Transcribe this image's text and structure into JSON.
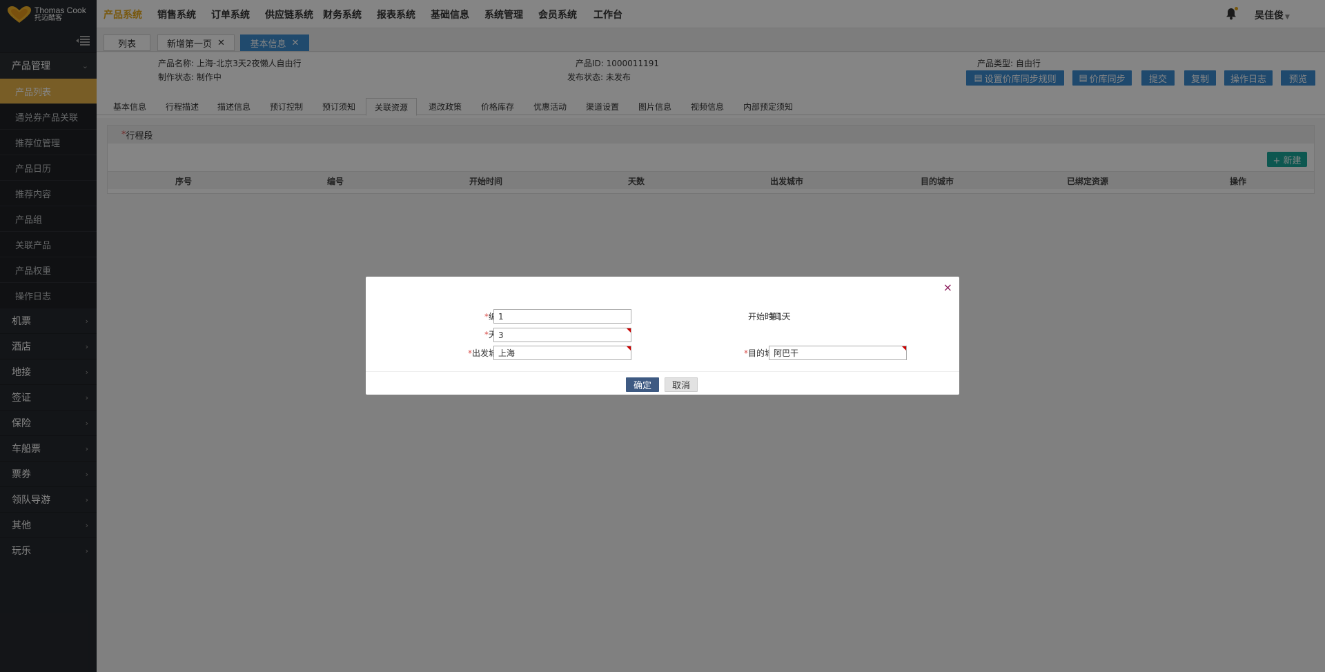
{
  "brand": {
    "name_en": "Thomas Cook",
    "name_cn": "托迈酷客"
  },
  "topnav": [
    "产品系统",
    "销售系统",
    "订单系统",
    "供应链系统",
    "财务系统",
    "报表系统",
    "基础信息",
    "系统管理",
    "会员系统",
    "工作台"
  ],
  "topnav_active": "产品系统",
  "user": {
    "name": "吴佳俊"
  },
  "sidebar": {
    "product_mgmt": "产品管理",
    "sub_items": [
      "产品列表",
      "通兑券产品关联",
      "推荐位管理",
      "产品日历",
      "推荐内容",
      "产品组",
      "关联产品",
      "产品权重",
      "操作日志"
    ],
    "groups": [
      "机票",
      "酒店",
      "地接",
      "签证",
      "保险",
      "车船票",
      "票券",
      "领队导游",
      "其他",
      "玩乐"
    ]
  },
  "tabs": [
    {
      "label": "列表"
    },
    {
      "label": "新增第一页",
      "close": "✕"
    },
    {
      "label": "基本信息",
      "close": "✕"
    }
  ],
  "info": {
    "product_name": "产品名称: 上海-北京3天2夜懒人自由行",
    "product_id": "产品ID: 1000011191",
    "product_type": "产品类型: 自由行",
    "make_status": "制作状态: 制作中",
    "publish_status": "发布状态: 未发布"
  },
  "actions": [
    "设置价库同步规则",
    "价库同步",
    "提交",
    "复制",
    "操作日志",
    "预览"
  ],
  "subtabs": [
    "基本信息",
    "行程描述",
    "描述信息",
    "预订控制",
    "预订须知",
    "关联资源",
    "退改政策",
    "价格库存",
    "优惠活动",
    "渠道设置",
    "图片信息",
    "视频信息",
    "内部预定须知"
  ],
  "subtab_active": "关联资源",
  "panel": {
    "title": "行程段",
    "new_button": "+ 新建",
    "columns": [
      "序号",
      "编号",
      "开始时间",
      "天数",
      "出发城市",
      "目的城市",
      "已绑定资源",
      "操作"
    ]
  },
  "modal": {
    "code_label": "编号:",
    "code_value": "1",
    "start_label": "开始时间:",
    "start_value": "第1天",
    "days_label": "天数:",
    "days_value": "3",
    "from_label": "出发城市:",
    "from_value": "上海",
    "to_label": "目的城市:",
    "to_value": "阿巴干",
    "ok": "确定",
    "cancel": "取消",
    "close": "×"
  },
  "colors": {
    "accent": "#e6a817",
    "primary": "#3c8dd1",
    "success": "#1aa79a",
    "sidebar_bg": "#26292e"
  }
}
